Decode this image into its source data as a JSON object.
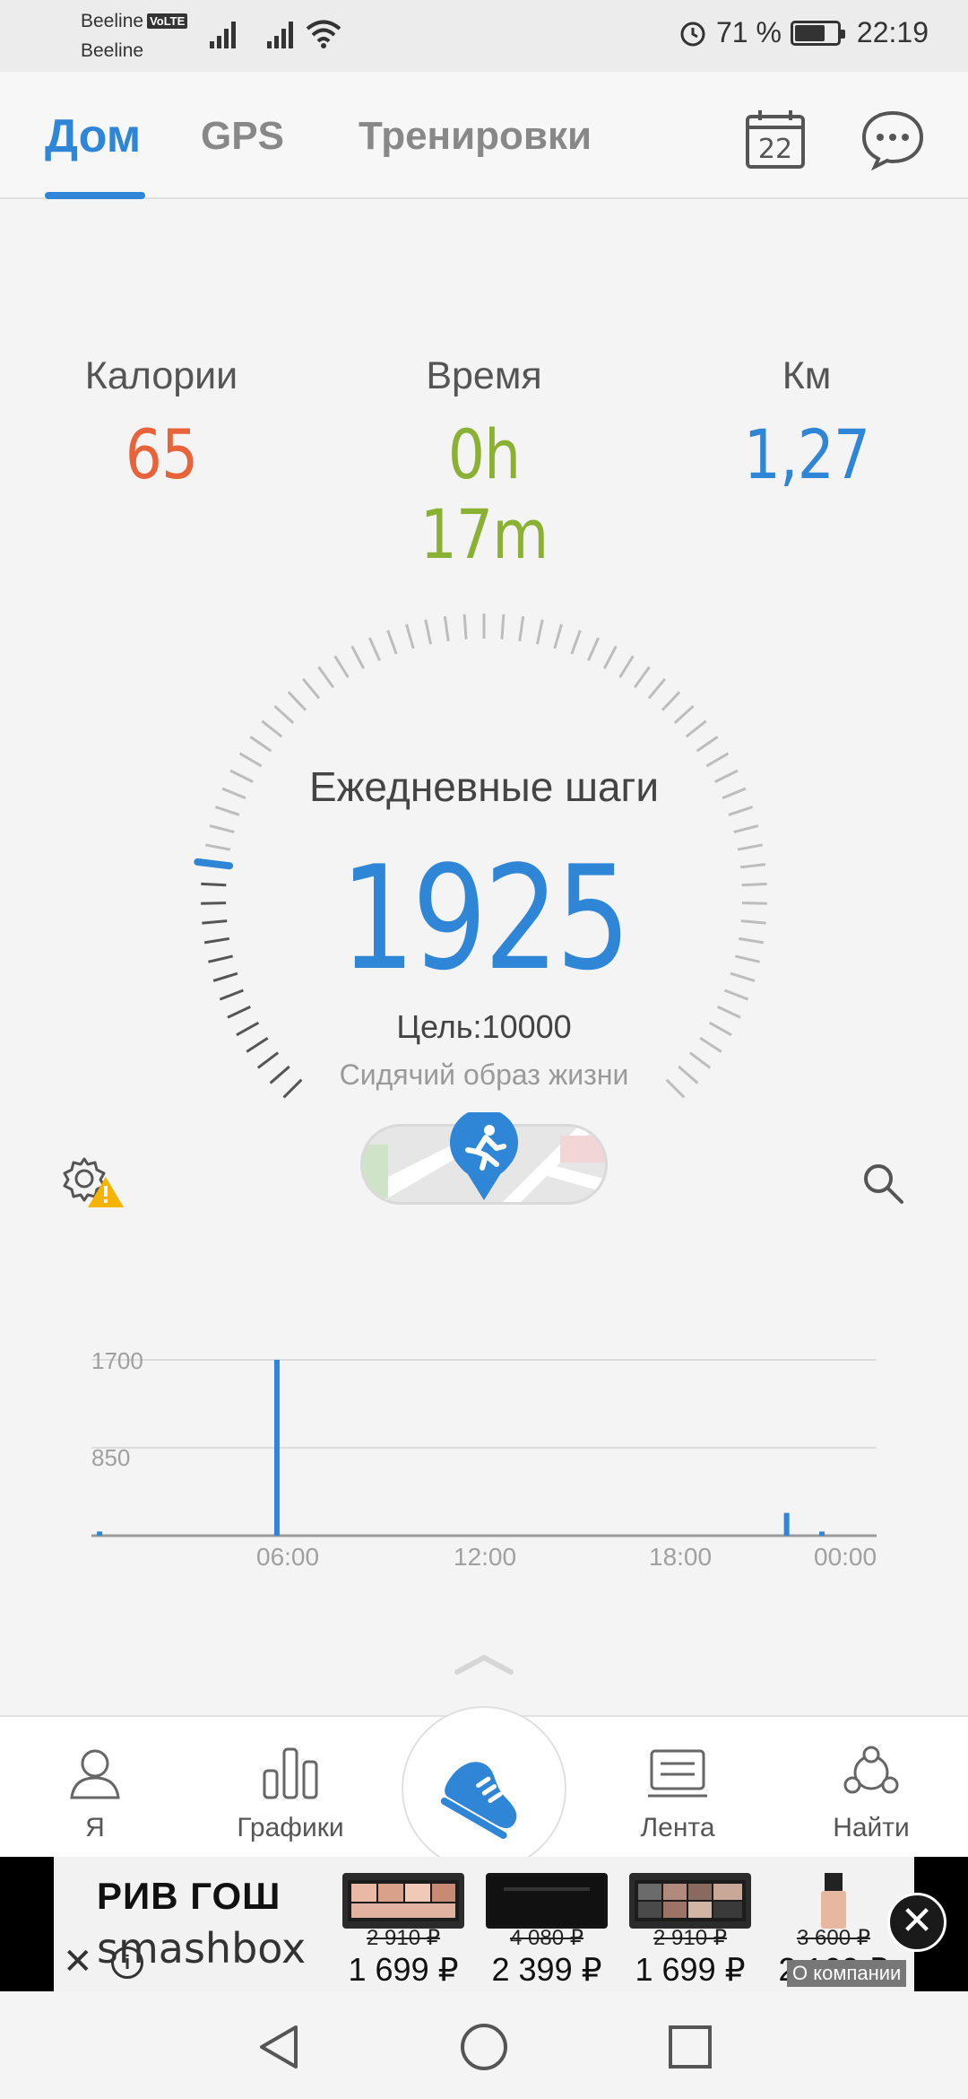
{
  "status_bar": {
    "carrier1": "Beeline",
    "carrier1_badge": "VoLTE",
    "carrier2": "Beeline",
    "battery_percent_text": "71 %",
    "battery_level": 0.71,
    "time": "22:19"
  },
  "header": {
    "tabs": [
      {
        "label": "Дом",
        "active": true
      },
      {
        "label": "GPS",
        "active": false
      },
      {
        "label": "Тренировки",
        "active": false
      }
    ],
    "calendar_day": "22",
    "icons": [
      "calendar-icon",
      "chat-icon"
    ]
  },
  "stats": {
    "calories": {
      "label": "Калории",
      "value": "65",
      "color": "#e8623a"
    },
    "time": {
      "label": "Время",
      "value": "0h 17m",
      "color": "#8ab034"
    },
    "km": {
      "label": "Км",
      "value": "1,27",
      "color": "#2f86d6"
    }
  },
  "gauge": {
    "title": "Ежедневные шаги",
    "steps": "1925",
    "goal": "Цель:10000",
    "status": "Сидячий образ жизни",
    "progress": 0.1925,
    "accent": "#2f86d6"
  },
  "chart_data": {
    "type": "bar",
    "x_ticks": [
      "06:00",
      "12:00",
      "18:00",
      "00:00"
    ],
    "y_ticks": [
      "1700",
      "850"
    ],
    "ylim": [
      0,
      1700
    ],
    "x_hours": [
      0.25,
      5.67,
      21.25,
      22.33
    ],
    "values": [
      40,
      1700,
      220,
      40
    ],
    "color": "#2f86d6"
  },
  "bottom_nav": {
    "items": [
      {
        "label": "Я",
        "icon": "profile-icon"
      },
      {
        "label": "Графики",
        "icon": "bar-chart-icon"
      },
      {
        "label": "Лента",
        "icon": "feed-icon"
      },
      {
        "label": "Найти",
        "icon": "find-friends-icon"
      }
    ],
    "center_icon": "running-shoe-icon"
  },
  "ad": {
    "brand1": "РИВ ГОШ",
    "brand2": "smashbox",
    "products": [
      {
        "old_price": "2 910 ₽",
        "new_price": "1 699 ₽"
      },
      {
        "old_price": "4 080 ₽",
        "new_price": "2 399 ₽"
      },
      {
        "old_price": "2 910 ₽",
        "new_price": "1 699 ₽"
      },
      {
        "old_price": "3 600 ₽",
        "new_price": "2 160 ₽"
      }
    ],
    "about": "О компании"
  }
}
